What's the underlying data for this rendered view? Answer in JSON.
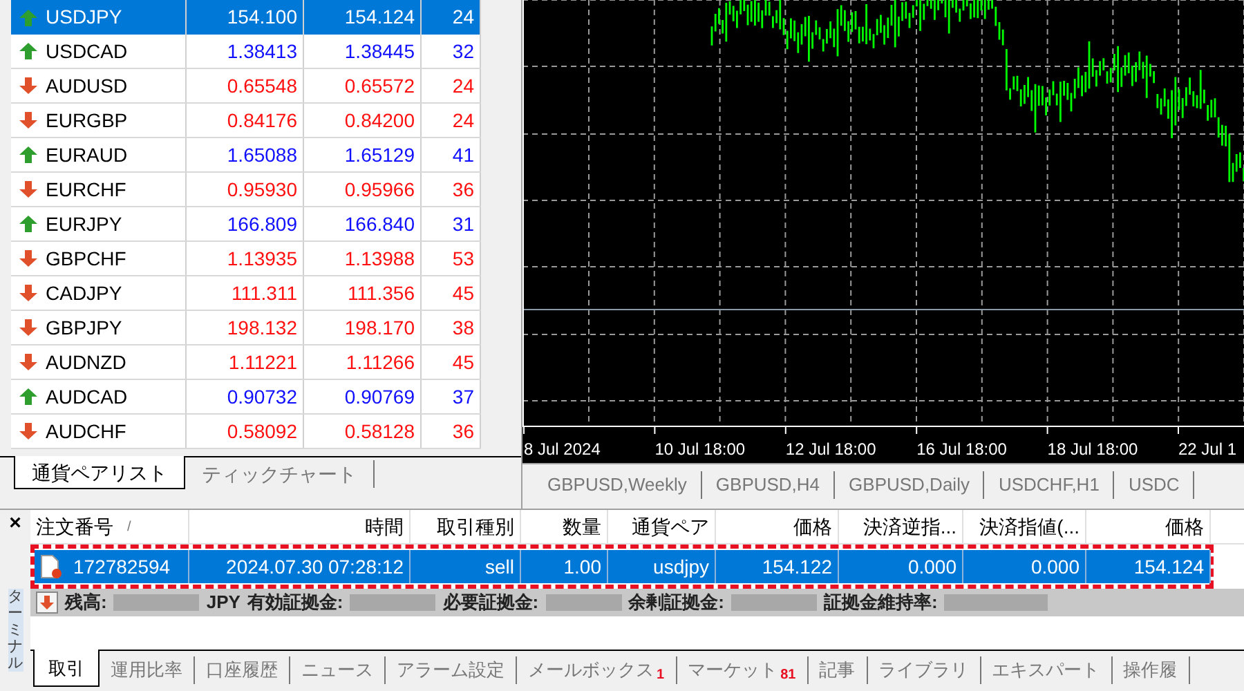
{
  "market_watch": {
    "rows": [
      {
        "symbol": "USDJPY",
        "bid": "154.100",
        "ask": "154.124",
        "spread": "24",
        "rising": true,
        "selected": true
      },
      {
        "symbol": "USDCAD",
        "bid": "1.38413",
        "ask": "1.38445",
        "spread": "32",
        "rising": true,
        "selected": false
      },
      {
        "symbol": "AUDUSD",
        "bid": "0.65548",
        "ask": "0.65572",
        "spread": "24",
        "rising": false,
        "selected": false
      },
      {
        "symbol": "EURGBP",
        "bid": "0.84176",
        "ask": "0.84200",
        "spread": "24",
        "rising": false,
        "selected": false
      },
      {
        "symbol": "EURAUD",
        "bid": "1.65088",
        "ask": "1.65129",
        "spread": "41",
        "rising": true,
        "selected": false
      },
      {
        "symbol": "EURCHF",
        "bid": "0.95930",
        "ask": "0.95966",
        "spread": "36",
        "rising": false,
        "selected": false
      },
      {
        "symbol": "EURJPY",
        "bid": "166.809",
        "ask": "166.840",
        "spread": "31",
        "rising": true,
        "selected": false
      },
      {
        "symbol": "GBPCHF",
        "bid": "1.13935",
        "ask": "1.13988",
        "spread": "53",
        "rising": false,
        "selected": false
      },
      {
        "symbol": "CADJPY",
        "bid": "111.311",
        "ask": "111.356",
        "spread": "45",
        "rising": false,
        "selected": false
      },
      {
        "symbol": "GBPJPY",
        "bid": "198.132",
        "ask": "198.170",
        "spread": "38",
        "rising": false,
        "selected": false
      },
      {
        "symbol": "AUDNZD",
        "bid": "1.11221",
        "ask": "1.11266",
        "spread": "45",
        "rising": false,
        "selected": false
      },
      {
        "symbol": "AUDCAD",
        "bid": "0.90732",
        "ask": "0.90769",
        "spread": "37",
        "rising": true,
        "selected": false
      },
      {
        "symbol": "AUDCHF",
        "bid": "0.58092",
        "ask": "0.58128",
        "spread": "36",
        "rising": false,
        "selected": false
      }
    ],
    "tabs": [
      {
        "label": "通貨ペアリスト",
        "selected": true
      },
      {
        "label": "ティックチャート",
        "selected": false
      }
    ]
  },
  "chart": {
    "time_labels": [
      "8 Jul 2024",
      "10 Jul 18:00",
      "12 Jul 18:00",
      "16 Jul 18:00",
      "18 Jul 18:00",
      "22 Jul 1"
    ],
    "tabs": [
      {
        "label": "GBPUSD,Weekly",
        "selected": false
      },
      {
        "label": "GBPUSD,H4",
        "selected": false
      },
      {
        "label": "GBPUSD,Daily",
        "selected": false
      },
      {
        "label": "USDCHF,H1",
        "selected": false
      },
      {
        "label": "USDC",
        "selected": false
      }
    ]
  },
  "terminal": {
    "close": "×",
    "title": "ターミナル",
    "columns": [
      "注文番号",
      "時間",
      "取引種別",
      "数量",
      "通貨ペア",
      "価格",
      "決済逆指...",
      "決済指値(...",
      "価格"
    ],
    "sort_mark": "/",
    "orders": [
      {
        "cells": [
          "172782594",
          "2024.07.30 07:28:12",
          "sell",
          "1.00",
          "usdjpy",
          "154.122",
          "0.000",
          "0.000",
          "154.124"
        ],
        "selected": true,
        "highlighted": true
      }
    ],
    "summary": [
      "残高:",
      "JPY",
      "有効証拠金:",
      "必要証拠金:",
      "余剰証拠金:",
      "証拠金維持率:"
    ],
    "tabs": [
      {
        "label": "取引",
        "selected": true
      },
      {
        "label": "運用比率",
        "selected": false
      },
      {
        "label": "口座履歴",
        "selected": false
      },
      {
        "label": "ニュース",
        "selected": false
      },
      {
        "label": "アラーム設定",
        "selected": false
      },
      {
        "label": "メールボックス",
        "badge": "1",
        "selected": false
      },
      {
        "label": "マーケット",
        "badge": "81",
        "selected": false
      },
      {
        "label": "記事",
        "selected": false
      },
      {
        "label": "ライブラリ",
        "selected": false
      },
      {
        "label": "エキスパート",
        "selected": false
      },
      {
        "label": "操作履",
        "selected": false
      }
    ]
  }
}
